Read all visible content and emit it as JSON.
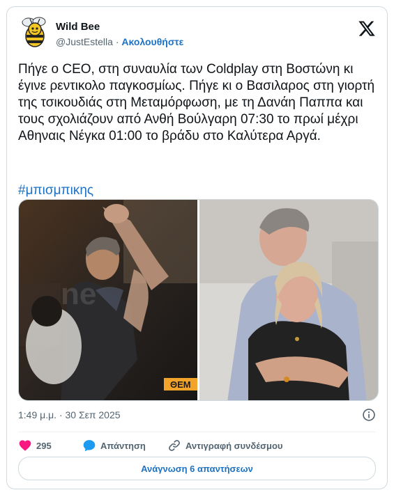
{
  "author": {
    "name": "Wild Bee",
    "handle": "@JustEstella",
    "separator": "·",
    "follow_label": "Ακολουθήστε"
  },
  "tweet": {
    "text": "Πήγε ο CEO, στη συναυλία των Coldplay στη Βοστώνη κι έγινε ρεντικολο παγκοσμίως. Πήγε κι ο Βασιλαρος στη γιορτή της τσικουδιάς στη Μεταμόρφωση, με τη Δανάη Παππα και τους σχολιάζουν από Ανθή Βούλγαρη 07:30 το πρωί μέχρι Αθηναις Νέγκα 01:00 το βράδυ στο Καλύτερα Αργά.",
    "hashtag": "#μπισμπικης",
    "timestamp": "1:49 μ.μ. · 30 Σεπ 2025",
    "media_watermark": "ΘΕΜ"
  },
  "actions": {
    "likes_count": "295",
    "reply_label": "Απάντηση",
    "copy_link_label": "Αντιγραφή συνδέσμου"
  },
  "read_replies_label": "Ανάγνωση 6 απαντήσεων",
  "colors": {
    "accent": "#1d72c4",
    "like": "#f91880",
    "reply": "#1d9bf0",
    "muted": "#536471"
  },
  "icons": [
    "bee-avatar",
    "x-logo-icon",
    "info-icon",
    "heart-icon",
    "reply-bubble-icon",
    "link-icon"
  ]
}
